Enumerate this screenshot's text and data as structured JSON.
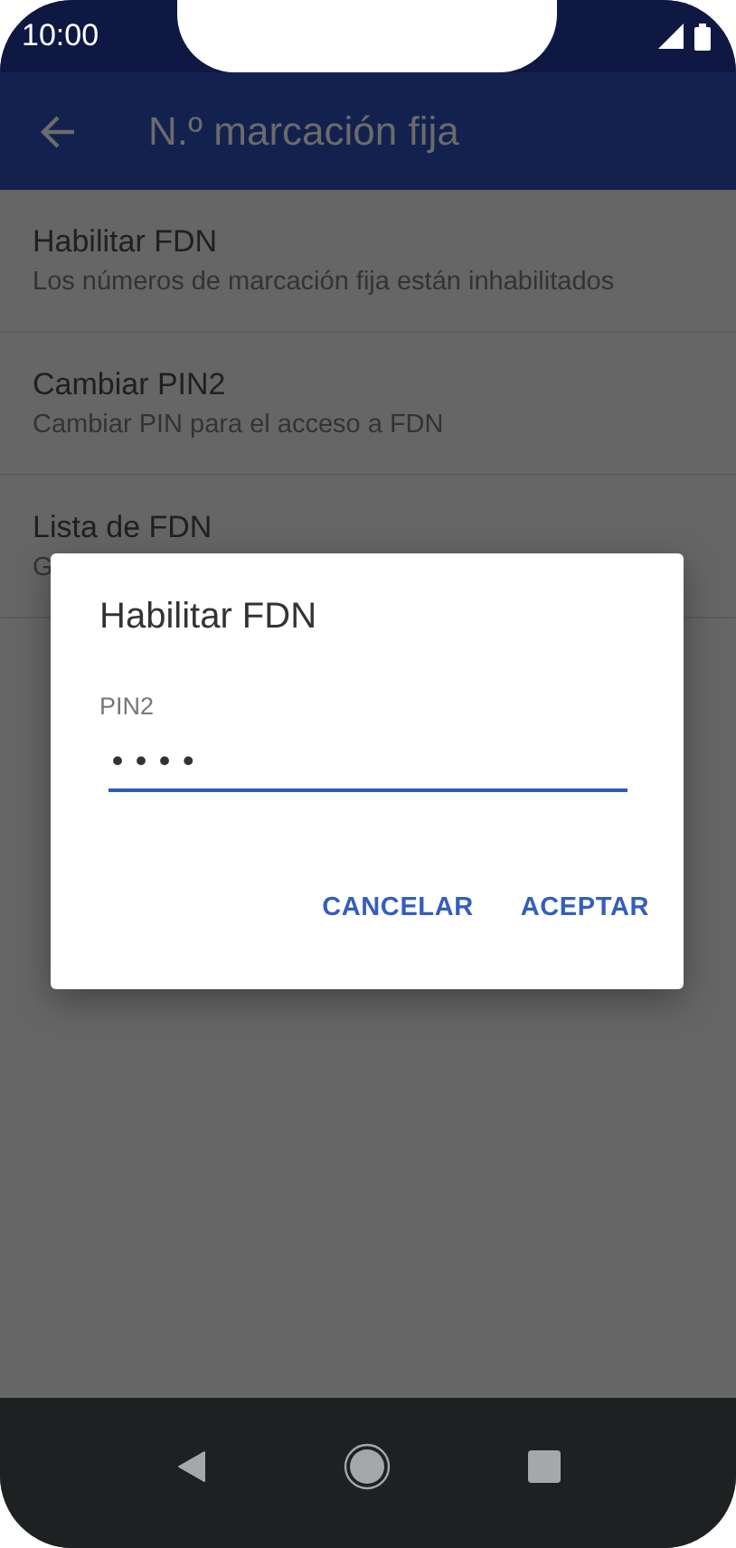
{
  "status_bar": {
    "time": "10:00"
  },
  "app_bar": {
    "title": "N.º marcación fija"
  },
  "items": [
    {
      "title": "Habilitar FDN",
      "subtitle": "Los números de marcación fija están inhabilitados"
    },
    {
      "title": "Cambiar PIN2",
      "subtitle": "Cambiar PIN para el acceso a FDN"
    },
    {
      "title": "Lista de FDN",
      "subtitle": "G"
    }
  ],
  "dialog": {
    "title": "Habilitar FDN",
    "field": {
      "label": "PIN2",
      "value": "••••"
    },
    "buttons": [
      "CANCELAR",
      "ACEPTAR"
    ]
  }
}
